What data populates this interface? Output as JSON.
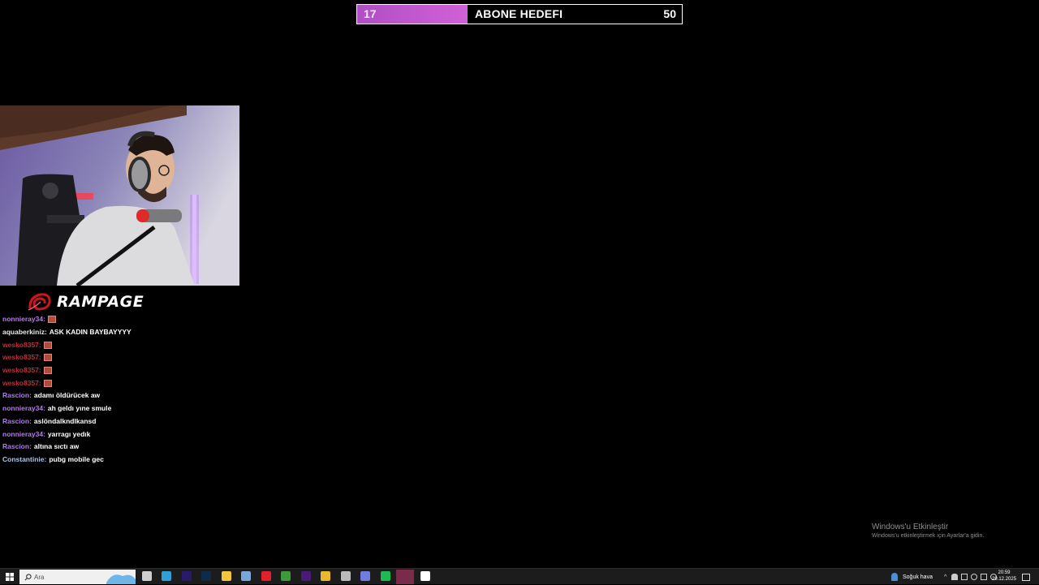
{
  "goal": {
    "current": "17",
    "title": "ABONE HEDEFI",
    "target": "50",
    "progress": 0.34,
    "fill_color": "#c95ad0"
  },
  "brand": {
    "name": "RAMPAGE",
    "logo_color": "#d0141e"
  },
  "chat": [
    {
      "user": "nonnieray34:",
      "text": "",
      "emote": true,
      "user_color": "#b57be8"
    },
    {
      "user": "aquaberkiniz:",
      "text": "ASK KADIN BAYBAYYYY",
      "emote": false,
      "user_color": "#e8e8e8"
    },
    {
      "user": "wesko8357:",
      "text": "",
      "emote": true,
      "user_color": "#c42b3b"
    },
    {
      "user": "wesko8357:",
      "text": "",
      "emote": true,
      "user_color": "#c42b3b"
    },
    {
      "user": "wesko8357:",
      "text": "",
      "emote": true,
      "user_color": "#c42b3b"
    },
    {
      "user": "wesko8357:",
      "text": "",
      "emote": true,
      "user_color": "#c42b3b"
    },
    {
      "user": "Rascion:",
      "text": "adamı öldürücek aw",
      "emote": false,
      "user_color": "#b57be8"
    },
    {
      "user": "nonnieray34:",
      "text": "ah geldı yıne smule",
      "emote": false,
      "user_color": "#b57be8"
    },
    {
      "user": "Rascion:",
      "text": "aslöndalkndlkansd",
      "emote": false,
      "user_color": "#b57be8"
    },
    {
      "user": "nonnieray34:",
      "text": "yarragı yedık",
      "emote": false,
      "user_color": "#b57be8"
    },
    {
      "user": "Rascion:",
      "text": "altına sıctı aw",
      "emote": false,
      "user_color": "#b57be8"
    },
    {
      "user": "Constantinie:",
      "text": "pubg mobile gec",
      "emote": false,
      "user_color": "#a9c8ee"
    }
  ],
  "watermark": {
    "title": "Windows'u Etkinleştir",
    "subtitle": "Windows'u etkinleştirmek için Ayarlar'a gidin."
  },
  "taskbar": {
    "search_placeholder": "Ara",
    "weather": "Soğuk hava",
    "time": "20:59",
    "date": "29.12.2025",
    "apps": [
      {
        "name": "task-view-icon",
        "color": "#cfcfcf"
      },
      {
        "name": "edge-icon",
        "color": "#2f9fd8"
      },
      {
        "name": "premiere-icon",
        "color": "#2a1a6e"
      },
      {
        "name": "photoshop-icon",
        "color": "#0e2b4a"
      },
      {
        "name": "file-explorer-icon",
        "color": "#f3c53c"
      },
      {
        "name": "notepad-icon",
        "color": "#7aa7d9"
      },
      {
        "name": "opera-icon",
        "color": "#e0202a"
      },
      {
        "name": "xbox-icon",
        "color": "#3c9a3a"
      },
      {
        "name": "premiere-pro-icon",
        "color": "#4a1a7a"
      },
      {
        "name": "chrome-icon",
        "color": "#e8b92f"
      },
      {
        "name": "settings-gear-icon",
        "color": "#bbbbbb"
      },
      {
        "name": "discord-icon",
        "color": "#6f7ce0"
      },
      {
        "name": "spotify-icon",
        "color": "#1db954"
      },
      {
        "name": "app-active-icon",
        "color": "#7a2a4a"
      },
      {
        "name": "gear-icon",
        "color": "#ffffff"
      }
    ]
  }
}
